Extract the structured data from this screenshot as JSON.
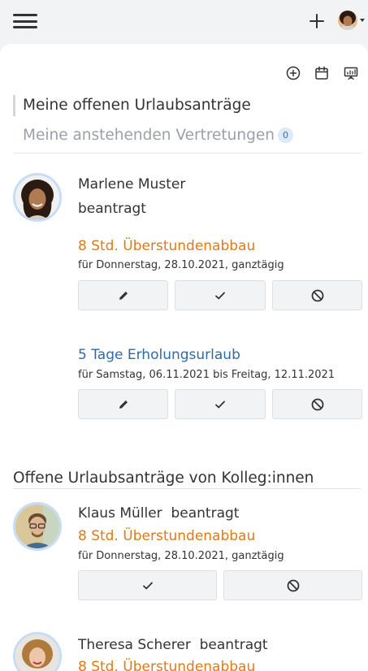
{
  "topbar": {
    "menu_icon": "hamburger-menu-icon",
    "add_icon": "plus-icon",
    "user_avatar": "user-avatar"
  },
  "toolbar": {
    "icons": [
      "add-circle-icon",
      "calendar-icon",
      "presentation-icon"
    ]
  },
  "tabs": {
    "my_open_requests": "Meine offenen Urlaubsanträge",
    "my_pending_substitutions": "Meine anstehenden Vertretungen",
    "substitutions_count": "0"
  },
  "my_requests": {
    "person": {
      "name": "Marlene Muster",
      "status": "beantragt"
    },
    "items": [
      {
        "type": "8 Std. Überstundenabbau",
        "date": "für Donnerstag, 28.10.2021, ganztägig",
        "color": "#e07a14"
      },
      {
        "type": "5 Tage Erholungsurlaub",
        "date": "für Samstag, 06.11.2021 bis Freitag, 12.11.2021",
        "color": "#2f6aa8"
      }
    ]
  },
  "colleagues": {
    "title": "Offene Urlaubsanträge von Kolleg:innen",
    "items": [
      {
        "name": "Klaus Müller",
        "status": "beantragt",
        "type": "8 Std. Überstundenabbau",
        "date": "für Donnerstag, 28.10.2021, ganztägig"
      },
      {
        "name": "Theresa Scherer",
        "status": "beantragt",
        "type": "8 Std. Überstundenabbau"
      }
    ]
  },
  "actions": {
    "edit_icon": "pencil-icon",
    "approve_icon": "check-icon",
    "reject_icon": "block-icon"
  }
}
